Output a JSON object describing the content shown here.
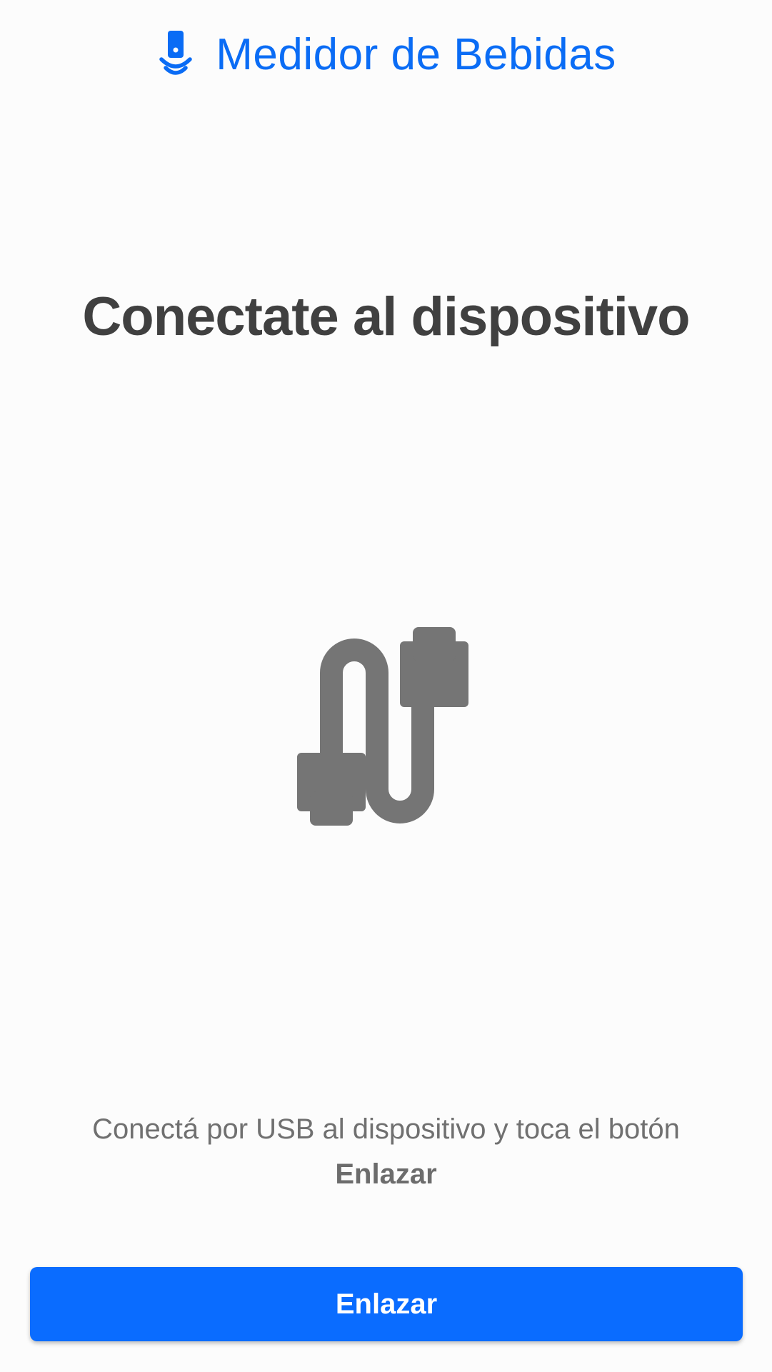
{
  "header": {
    "icon": "drink-meter-icon",
    "title": "Medidor de Bebidas"
  },
  "main": {
    "heading": "Conectate al dispositivo",
    "illustration_icon": "usb-cable-icon",
    "instruction_line1": "Conectá por USB al dispositivo y toca el botón",
    "instruction_line2": "Enlazar"
  },
  "actions": {
    "link_button_label": "Enlazar"
  },
  "colors": {
    "accent": "#0a6cff",
    "title_text": "#0a6cf5",
    "heading_text": "#404040",
    "body_text": "#707070",
    "icon_gray": "#757575",
    "background": "#fcfcfc"
  }
}
